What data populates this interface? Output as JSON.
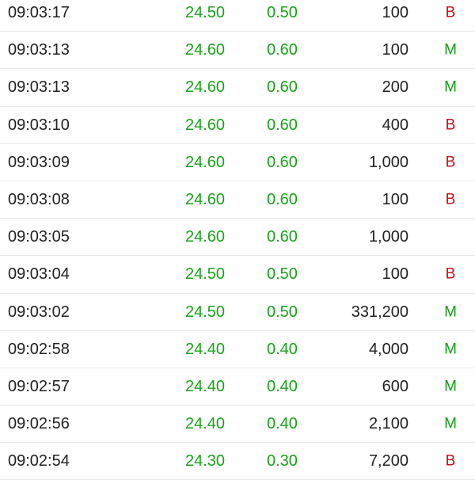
{
  "colors": {
    "up_green": "#1aa31a",
    "buy_red": "#c0141b",
    "sell_green": "#14a01a",
    "text_dark": "#222222",
    "divider": "#e9e9e9"
  },
  "trades": [
    {
      "time": "09:03:17",
      "price": "24.50",
      "change": "0.50",
      "volume": "100",
      "side": "B"
    },
    {
      "time": "09:03:13",
      "price": "24.60",
      "change": "0.60",
      "volume": "100",
      "side": "M"
    },
    {
      "time": "09:03:13",
      "price": "24.60",
      "change": "0.60",
      "volume": "200",
      "side": "M"
    },
    {
      "time": "09:03:10",
      "price": "24.60",
      "change": "0.60",
      "volume": "400",
      "side": "B"
    },
    {
      "time": "09:03:09",
      "price": "24.60",
      "change": "0.60",
      "volume": "1,000",
      "side": "B"
    },
    {
      "time": "09:03:08",
      "price": "24.60",
      "change": "0.60",
      "volume": "100",
      "side": "B"
    },
    {
      "time": "09:03:05",
      "price": "24.60",
      "change": "0.60",
      "volume": "1,000",
      "side": ""
    },
    {
      "time": "09:03:04",
      "price": "24.50",
      "change": "0.50",
      "volume": "100",
      "side": "B"
    },
    {
      "time": "09:03:02",
      "price": "24.50",
      "change": "0.50",
      "volume": "331,200",
      "side": "M"
    },
    {
      "time": "09:02:58",
      "price": "24.40",
      "change": "0.40",
      "volume": "4,000",
      "side": "M"
    },
    {
      "time": "09:02:57",
      "price": "24.40",
      "change": "0.40",
      "volume": "600",
      "side": "M"
    },
    {
      "time": "09:02:56",
      "price": "24.40",
      "change": "0.40",
      "volume": "2,100",
      "side": "M"
    },
    {
      "time": "09:02:54",
      "price": "24.30",
      "change": "0.30",
      "volume": "7,200",
      "side": "B"
    }
  ]
}
